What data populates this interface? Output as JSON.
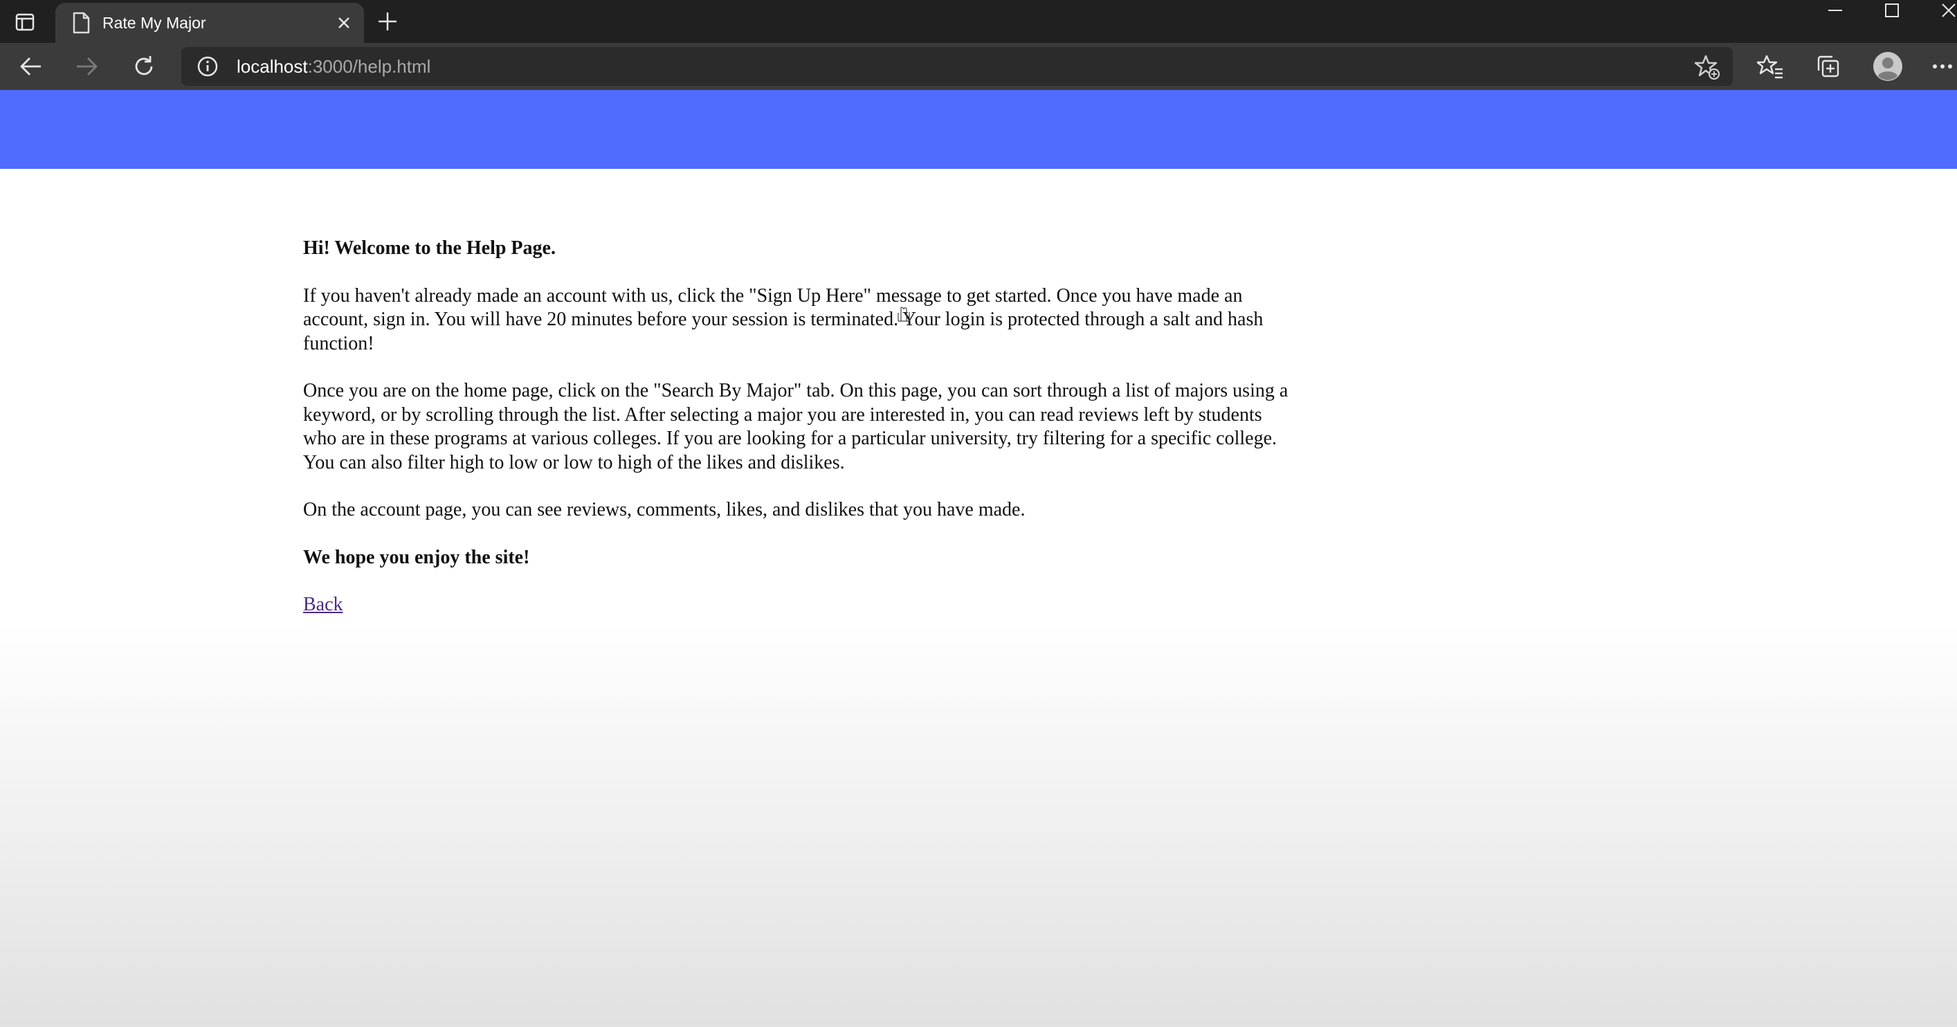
{
  "browser": {
    "tab_title": "Rate My Major",
    "url_host": "localhost",
    "url_path": ":3000/help.html",
    "colors": {
      "titlebar": "#202020",
      "toolbar": "#3b3b3b",
      "address_bar": "#2b2b2b"
    },
    "icons": {
      "sidebar_toggle": "tab-actions-icon",
      "tab_page": "page-icon",
      "tab_close": "close-icon",
      "new_tab": "plus-icon",
      "back": "back-arrow-icon",
      "forward": "forward-arrow-icon",
      "refresh": "refresh-icon",
      "site_info": "info-icon",
      "add_favorite": "star-plus-icon",
      "favorites": "favorites-icon",
      "collections": "collections-icon",
      "profile": "profile-icon",
      "more": "more-icon"
    }
  },
  "page": {
    "header_color": "#4f6cff",
    "welcome": "Hi! Welcome to the Help Page.",
    "paragraph_signup": "If you haven't already made an account with us, click the \"Sign Up Here\" message to get started. Once you have made an account, sign in. You will have 20 minutes before your session is terminated. Your login is protected through a salt and hash function!",
    "paragraph_search": "Once you are on the home page, click on the \"Search By Major\" tab. On this page, you can sort through a list of majors using a keyword, or by scrolling through the list. After selecting a major you are interested in, you can read reviews left by students who are in these programs at various colleges. If you are looking for a particular university, try filtering for a specific college. You can also filter high to low or low to high of the likes and dislikes.",
    "paragraph_account": "On the account page, you can see reviews, comments, likes, and dislikes that you have made.",
    "closing": "We hope you enjoy the site!",
    "back_link": "Back"
  }
}
